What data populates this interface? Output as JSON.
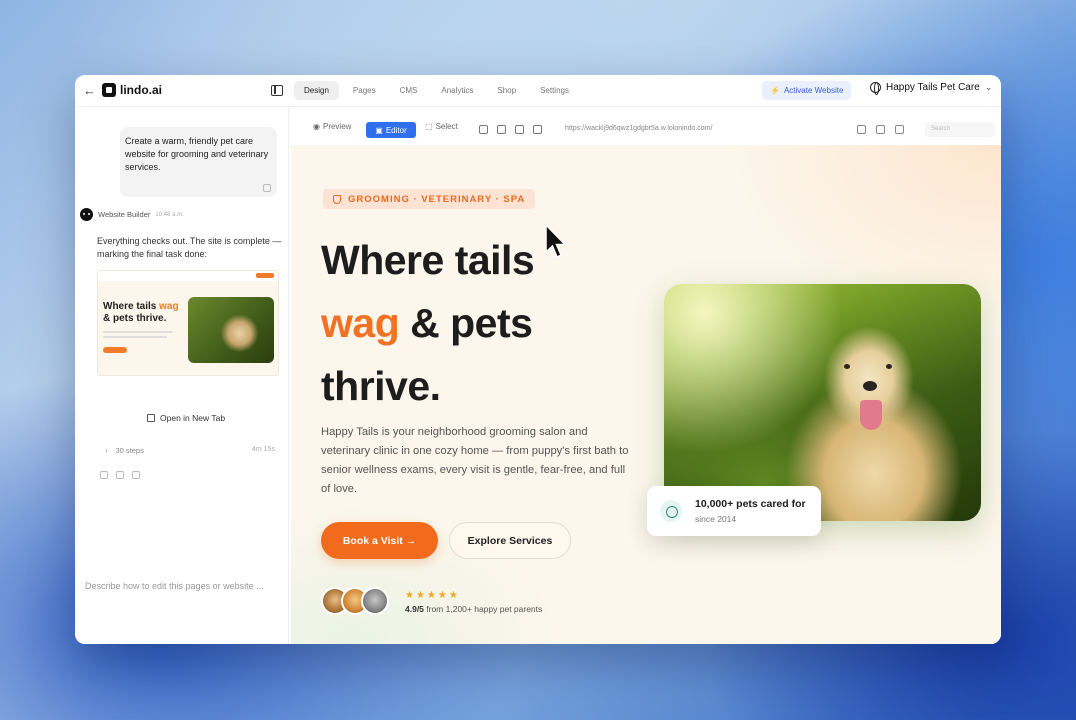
{
  "app": {
    "logo_text": "lindo.ai",
    "tabs": [
      {
        "label": "Design",
        "active": true
      },
      {
        "label": "Pages"
      },
      {
        "label": "CMS"
      },
      {
        "label": "Analytics"
      },
      {
        "label": "Shop"
      },
      {
        "label": "Settings"
      }
    ],
    "activate_label": "Activate Website",
    "site_name": "Happy Tails Pet Care"
  },
  "chat": {
    "user_message": "Create a warm, friendly pet care website for grooming and veterinary services.",
    "bot_name": "Website Builder",
    "bot_time": "10:48 a.m.",
    "bot_message": "Everything checks out. The site is complete — marking the final task done:",
    "thumb_title_a": "Where tails ",
    "thumb_title_accent": "wag",
    "thumb_title_b": " & pets thrive.",
    "open_tab_label": "Open in New Tab",
    "steps_label": "30 steps",
    "steps_time": "4m 15s",
    "composer_placeholder": "Describe how to edit this pages or website ...",
    "plus_label": "+",
    "send_label": "↑"
  },
  "toolbar": {
    "preview_label": "Preview",
    "editor_label": "Editor",
    "select_label": "Select",
    "url": "https://wacklj9d6qwz1gdgbr5a.w.lolonindo.com/",
    "input_placeholder": "Search"
  },
  "hero": {
    "badge": "GROOMING · VETERINARY · SPA",
    "title_line1": "Where tails",
    "title_accent": "wag",
    "title_line2_rest": " & pets",
    "title_line3": "thrive.",
    "description": "Happy Tails is your neighborhood grooming salon and veterinary clinic in one cozy home — from puppy's first bath to senior wellness exams, every visit is gentle, fear-free, and full of love.",
    "primary_button": "Book a Visit →",
    "secondary_button": "Explore Services",
    "stars": "★★★★★",
    "rating_score": "4.9/5",
    "rating_text": " from 1,200+ happy pet parents",
    "stat_title": "10,000+ pets cared for",
    "stat_sub": "since 2014"
  },
  "colors": {
    "accent": "#f26a1b",
    "editor_blue": "#2f6fed",
    "activate_blue": "#3b5bdb"
  }
}
